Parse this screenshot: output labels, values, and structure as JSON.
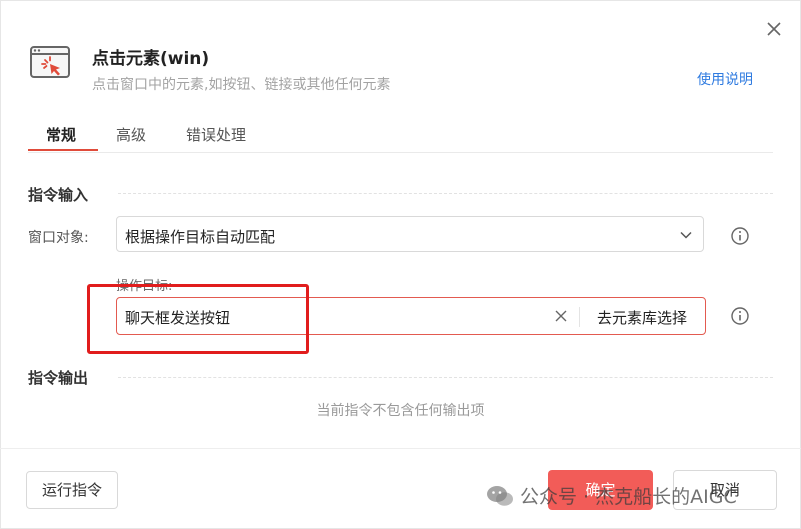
{
  "dialog": {
    "title": "点击元素(win)",
    "subtitle": "点击窗口中的元素,如按钮、链接或其他任何元素",
    "help_link": "使用说明"
  },
  "tabs": [
    {
      "label": "常规",
      "active": true
    },
    {
      "label": "高级",
      "active": false
    },
    {
      "label": "错误处理",
      "active": false
    }
  ],
  "input_section": {
    "title": "指令输入",
    "window_object": {
      "label": "窗口对象:",
      "value": "根据操作目标自动匹配"
    },
    "operation_target": {
      "label": "操作目标:",
      "value": "聊天框发送按钮",
      "library_button": "去元素库选择"
    }
  },
  "output_section": {
    "title": "指令输出",
    "empty_text": "当前指令不包含任何输出项"
  },
  "footer": {
    "run_button": "运行指令",
    "ok_button": "确定",
    "cancel_button": "取消"
  },
  "watermark": {
    "text": "公众号 · 杰克船长的AIGC"
  },
  "colors": {
    "accent_red": "#e04b3a",
    "primary_button": "#f25c58",
    "link_blue": "#2f7be0",
    "highlight_box": "#e11d1d"
  }
}
